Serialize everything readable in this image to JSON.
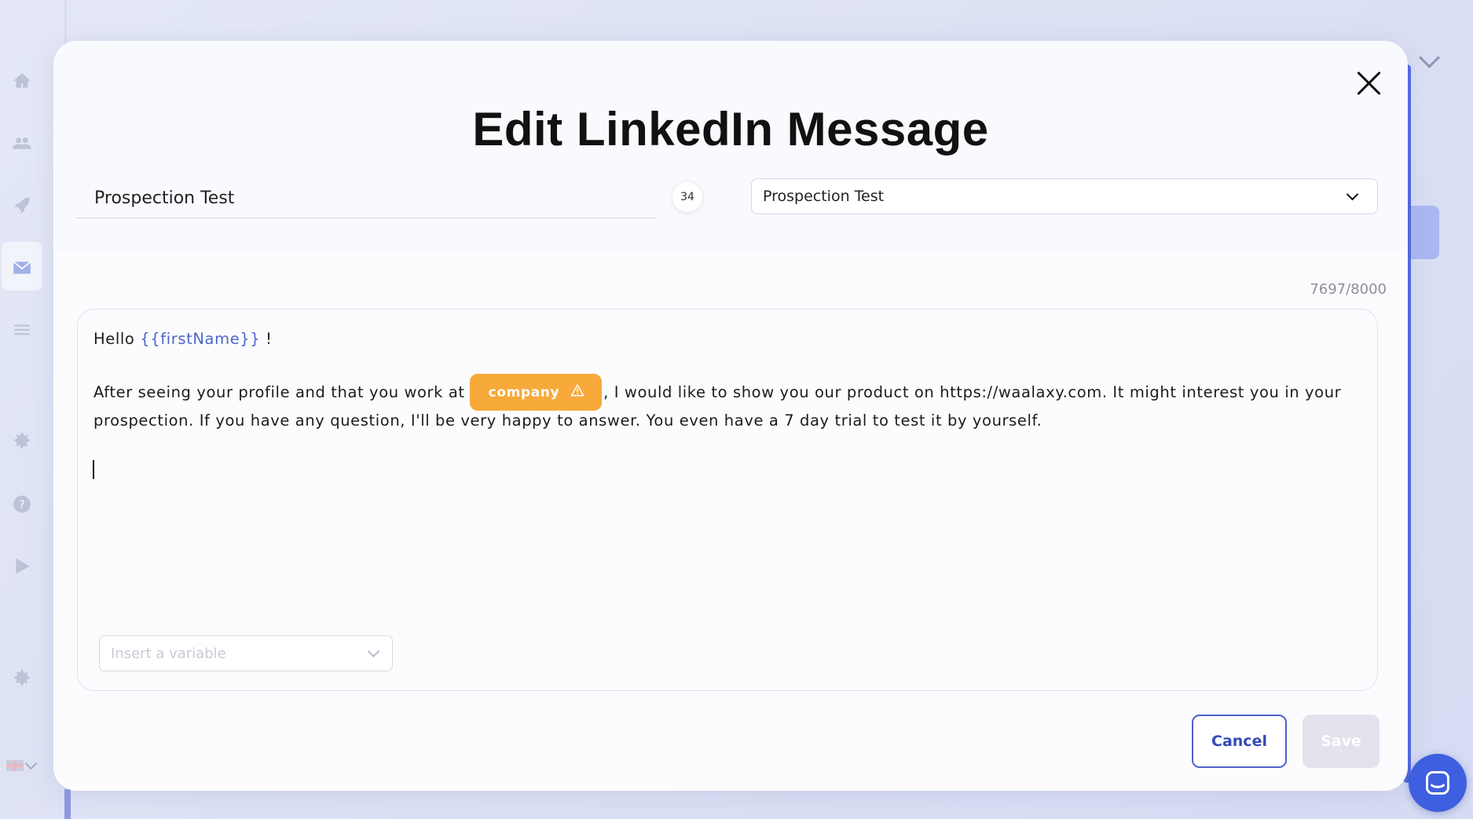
{
  "modal": {
    "title": "Edit LinkedIn Message",
    "name_field_value": "Prospection Test",
    "name_counter": "34",
    "campaign_select_value": "Prospection Test",
    "char_count": "7697/8000"
  },
  "editor": {
    "greeting": "Hello",
    "first_name_var": "{{firstName}}",
    "exclaim": "!",
    "body_before_chip": "After seeing your profile and that you work at",
    "company_chip_label": "company",
    "body_after_chip": ", I would like to show you our product on https://waalaxy.com. It might interest you in your",
    "body_line2": "prospection. If you have any question, I'll be very happy to answer. You even have a 7 day trial to test it by yourself.",
    "insert_variable_placeholder": "Insert a variable"
  },
  "actions": {
    "cancel_label": "Cancel",
    "save_label": "Save"
  },
  "sidebar": {
    "items": [
      "home-icon",
      "users-icon",
      "rocket-icon",
      "mail-icon",
      "list-icon",
      "gear-icon",
      "help-icon",
      "play-icon",
      "settings-icon"
    ],
    "active": "mail-icon"
  },
  "colors": {
    "accent": "#4c63c8",
    "variable_text": "#4a66c9",
    "chip": "#f7a93a",
    "chat_bubble": "#3e5fe0"
  }
}
